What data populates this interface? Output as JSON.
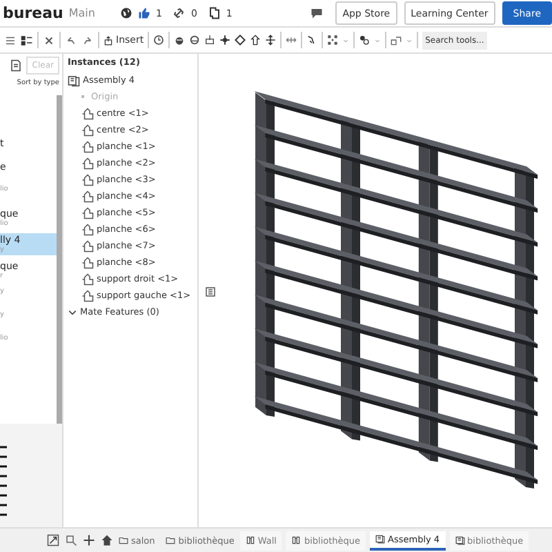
{
  "document": {
    "title": "bureau",
    "branch": "Main",
    "likes": "1",
    "links": "0",
    "copies": "1"
  },
  "header_buttons": [
    {
      "label": "App Store",
      "kind": "plain"
    },
    {
      "label": "Learning Center",
      "kind": "plain"
    },
    {
      "label": "Share",
      "kind": "primary"
    }
  ],
  "toolbar": {
    "insert": "Insert",
    "search_placeholder": "Search tools..."
  },
  "filter": {
    "clear": "Clear",
    "sort": "Sort by type"
  },
  "documents_list": [
    {
      "name": "t",
      "selected": false
    },
    {
      "name": "e",
      "selected": false
    },
    {
      "sub": "lio",
      "selected": false
    },
    {
      "name": "que",
      "sub": "lio",
      "selected": false
    },
    {
      "name": "lly 4",
      "sub": "y",
      "selected": true
    },
    {
      "name": "que",
      "sub": "r",
      "selected": false
    },
    {
      "sub": "y",
      "selected": false
    },
    {
      "sub": "y",
      "selected": false
    },
    {
      "sub": "lio",
      "selected": false
    }
  ],
  "instances": {
    "title": "Instances (12)",
    "root": "Assembly 4",
    "origin": "Origin",
    "items": [
      "centre <1>",
      "centre <2>",
      "planche <1>",
      "planche <2>",
      "planche <3>",
      "planche <4>",
      "planche <5>",
      "planche <6>",
      "planche <7>",
      "planche <8>",
      "support droit <1>",
      "support gauche <1>"
    ],
    "mates": {
      "label": "Mate Features (0)",
      "expanded": true
    }
  },
  "breadcrumbs": [
    "salon",
    "bibliothèque"
  ],
  "tabs": [
    {
      "label": "Wall",
      "kind": "part",
      "selected": false
    },
    {
      "label": "bibliothèque",
      "kind": "part",
      "selected": false
    },
    {
      "label": "Assembly 4",
      "kind": "assembly",
      "selected": true
    },
    {
      "label": "bibliothèque",
      "kind": "assembly",
      "selected": false
    }
  ]
}
